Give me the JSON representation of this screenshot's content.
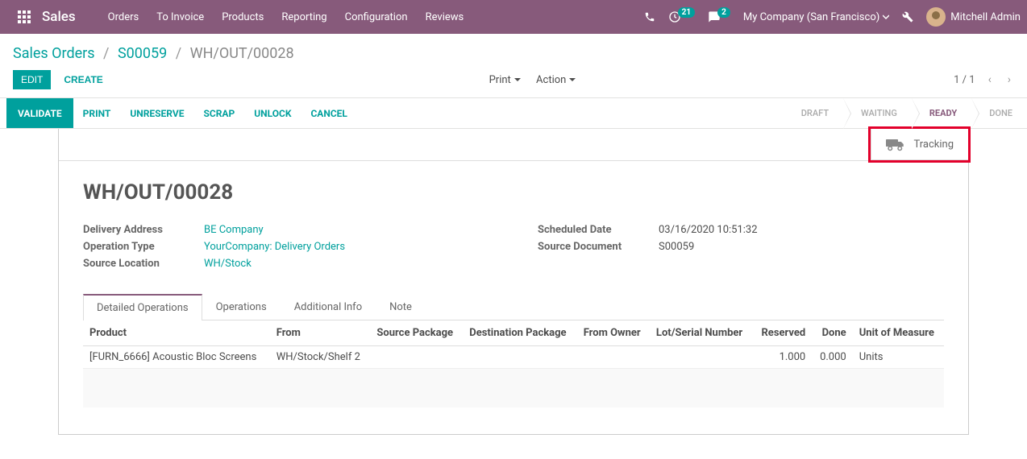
{
  "navbar": {
    "brand": "Sales",
    "menu": [
      "Orders",
      "To Invoice",
      "Products",
      "Reporting",
      "Configuration",
      "Reviews"
    ],
    "activities_badge": "21",
    "discuss_badge": "2",
    "company": "My Company (San Francisco)",
    "user": "Mitchell Admin"
  },
  "breadcrumb": {
    "items": [
      "Sales Orders",
      "S00059"
    ],
    "current": "WH/OUT/00028"
  },
  "cp": {
    "edit": "EDIT",
    "create": "CREATE",
    "print": "Print",
    "action": "Action",
    "pager": "1 / 1"
  },
  "statusbar_buttons": {
    "validate": "VALIDATE",
    "print": "PRINT",
    "unreserve": "UNRESERVE",
    "scrap": "SCRAP",
    "unlock": "UNLOCK",
    "cancel": "CANCEL"
  },
  "stages": {
    "draft": "DRAFT",
    "waiting": "WAITING",
    "ready": "READY",
    "done": "DONE"
  },
  "stat_button": {
    "tracking": "Tracking"
  },
  "record": {
    "name": "WH/OUT/00028",
    "labels": {
      "delivery_address": "Delivery Address",
      "operation_type": "Operation Type",
      "source_location": "Source Location",
      "scheduled_date": "Scheduled Date",
      "source_document": "Source Document"
    },
    "values": {
      "delivery_address": "BE Company",
      "operation_type": "YourCompany: Delivery Orders",
      "source_location": "WH/Stock",
      "scheduled_date": "03/16/2020 10:51:32",
      "source_document": "S00059"
    }
  },
  "tabs": {
    "detailed": "Detailed Operations",
    "operations": "Operations",
    "additional": "Additional Info",
    "note": "Note"
  },
  "table": {
    "headers": {
      "product": "Product",
      "from": "From",
      "source_package": "Source Package",
      "dest_package": "Destination Package",
      "from_owner": "From Owner",
      "lot": "Lot/Serial Number",
      "reserved": "Reserved",
      "done": "Done",
      "uom": "Unit of Measure"
    },
    "rows": [
      {
        "product": "[FURN_6666] Acoustic Bloc Screens",
        "from": "WH/Stock/Shelf 2",
        "source_package": "",
        "dest_package": "",
        "from_owner": "",
        "lot": "",
        "reserved": "1.000",
        "done": "0.000",
        "uom": "Units"
      }
    ]
  }
}
